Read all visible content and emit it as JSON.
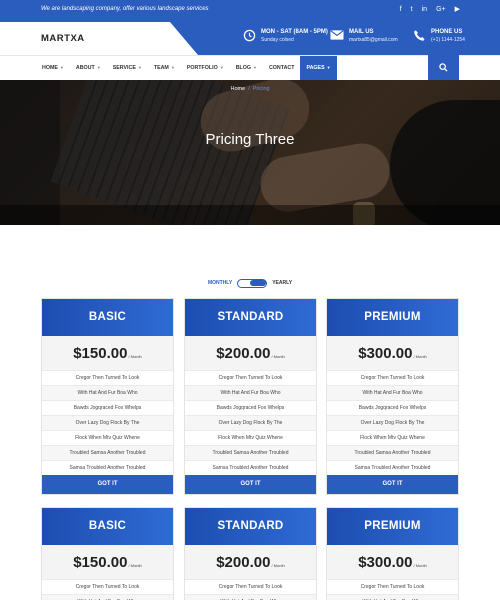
{
  "topbar": {
    "tagline": "We are landscaping company, offer various landscape services",
    "social": [
      "facebook-icon",
      "twitter-icon",
      "linkedin-icon",
      "google-plus-icon",
      "youtube-icon"
    ],
    "social_glyphs": [
      "f",
      "t",
      "in",
      "G+",
      "▶"
    ]
  },
  "header": {
    "logo": "MARTXA",
    "hours_title": "MON - SAT (8AM - 5PM)",
    "hours_sub": "Sunday colsed",
    "mail_title": "MAIL US",
    "mail_sub": "martxa85@gmail.com",
    "phone_title": "PHONE US",
    "phone_sub": "(+1) 1144-1254"
  },
  "nav": {
    "items": [
      {
        "label": "HOME",
        "caret": true
      },
      {
        "label": "ABOUT",
        "caret": true
      },
      {
        "label": "SERVICE",
        "caret": true
      },
      {
        "label": "TEAM",
        "caret": true
      },
      {
        "label": "PORTFOLIO",
        "caret": true
      },
      {
        "label": "BLOG",
        "caret": true
      },
      {
        "label": "CONTACT",
        "caret": false
      },
      {
        "label": "PAGES",
        "caret": true,
        "active": true
      }
    ]
  },
  "hero": {
    "title": "Pricing Three",
    "breadcrumb": {
      "home": "Home",
      "sep": "/",
      "current": "Pricing"
    }
  },
  "toggle": {
    "monthly": "MONTHLY",
    "yearly": "YEARLY"
  },
  "plans": [
    {
      "name": "BASIC",
      "price": "$150.00",
      "period": "/ Month"
    },
    {
      "name": "STANDARD",
      "price": "$200.00",
      "period": "/ Month"
    },
    {
      "name": "PREMIUM",
      "price": "$300.00",
      "period": "/ Month"
    },
    {
      "name": "BASIC",
      "price": "$150.00",
      "period": "/ Month"
    },
    {
      "name": "STANDARD",
      "price": "$200.00",
      "period": "/ Month"
    },
    {
      "name": "PREMIUM",
      "price": "$300.00",
      "period": "/ Month"
    }
  ],
  "features": [
    "Cregor Then Turned To Look",
    "With Hat And Fur Boa Who",
    "Bawds Jogqraced Fox Whelps",
    "Over Lazy Dog Flock By The",
    "Flock When Mtv Quiz Whene",
    "Troubled Samsa Another Troubled",
    "Samsa Troubled Another Troubled"
  ],
  "cta_label": "GOT IT",
  "colors": {
    "accent": "#2a5dbd"
  }
}
